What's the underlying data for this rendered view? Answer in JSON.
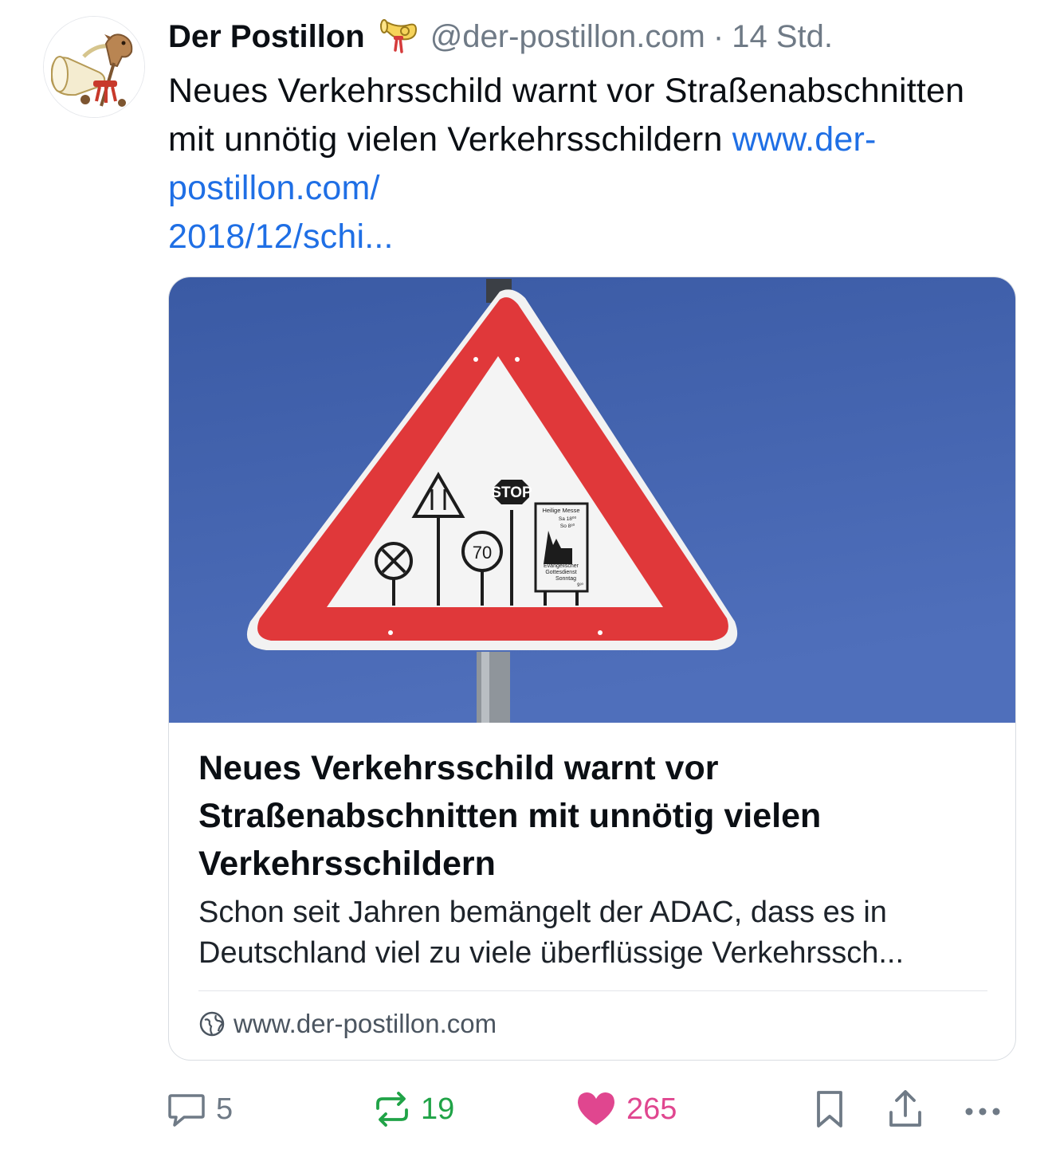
{
  "post": {
    "author_name": "Der Postillon",
    "handle": "@der-postillon.com",
    "separator": "·",
    "time": "14 Std.",
    "text": "Neues Verkehrsschild warnt vor Straßenabschnitten mit unnötig vielen Verkehrsschildern ",
    "link_text": "www.der-postillon.com/\n2018/12/schi..."
  },
  "card": {
    "title": "Neues Verkehrsschild warnt vor Straßenabschnitten mit unnötig vielen Verkehrsschildern",
    "description": "Schon seit Jahren bemängelt der ADAC, dass es in Deutschland viel zu viele überflüssige Verkehrssch...",
    "domain": "www.der-postillon.com",
    "sign_texts": {
      "stop": "STOP",
      "speed": "70",
      "church_top": "Heilige Messe",
      "church_sa": "Sa  18⁰⁰",
      "church_so": "So   8³⁰",
      "church_bottom1": "Evangelischer",
      "church_bottom2": "Gottesdienst",
      "church_bottom3": "Sonntag",
      "church_bottom4": "9³⁰"
    }
  },
  "actions": {
    "reply_count": "5",
    "repost_count": "19",
    "like_count": "265"
  },
  "colors": {
    "link": "#1f6fe5",
    "repost": "#20a347",
    "like": "#e0468f",
    "muted": "#6f7a86",
    "sky": "#3f62a8",
    "sign_red": "#e0383a"
  },
  "icons": [
    "avatar-posthorn",
    "verified-posthorn-icon",
    "globe-icon",
    "reply-icon",
    "repost-icon",
    "heart-icon",
    "bookmark-icon",
    "share-icon",
    "more-icon"
  ]
}
